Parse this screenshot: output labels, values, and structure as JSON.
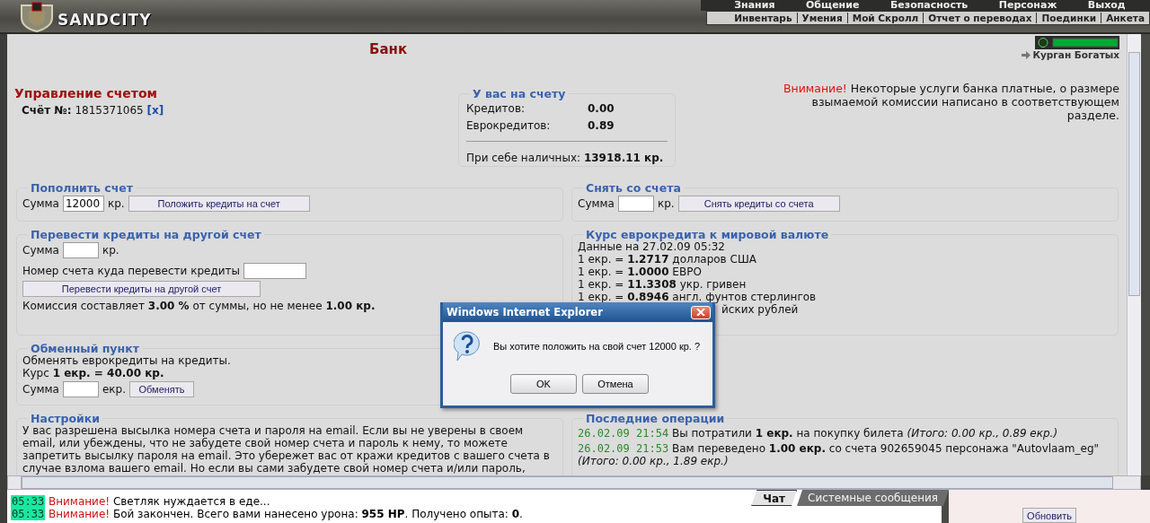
{
  "header": {
    "logo": "SANDCITY",
    "menu": [
      "Знания",
      "Общение",
      "Безопасность",
      "Персонаж",
      "Выход"
    ],
    "submenu": [
      "Инвентарь",
      "Умения",
      "Мой Скролл",
      "Отчет о переводах",
      "Поединки",
      "Анкета"
    ]
  },
  "page": {
    "title": "Банк",
    "location": "Курган Богатых"
  },
  "account": {
    "heading": "Управление счетом",
    "number_label": "Счёт №:",
    "number": "1815371065",
    "close_link": "[x]"
  },
  "balance": {
    "legend": "У вас на счету",
    "rows": [
      {
        "label": "Кредитов:",
        "value": "0.00"
      },
      {
        "label": "Еврокредитов:",
        "value": "0.89"
      }
    ],
    "cash_label": "При себе наличных:",
    "cash": "13918.11 кр."
  },
  "notice": {
    "alert": "Внимание!",
    "text": "Некоторые услуги банка платные, о размере взымаемой комиссии написано в соответствующем разделе."
  },
  "deposit": {
    "legend": "Пополнить счет",
    "amount_label": "Сумма",
    "value": "12000",
    "unit": "кр.",
    "button": "Положить кредиты на счет"
  },
  "withdraw": {
    "legend": "Снять со счета",
    "amount_label": "Сумма",
    "unit": "кр.",
    "button": "Снять кредиты со счета"
  },
  "transfer": {
    "legend": "Перевести кредиты на другой счет",
    "amount_label": "Сумма",
    "unit": "кр.",
    "account_label": "Номер счета куда перевести кредиты",
    "button": "Перевести кредиты на другой счет",
    "fee": "Комиссия составляет **3.00 %** от суммы, но не менее **1.00 кр.**"
  },
  "rates": {
    "legend": "Курс еврокредита к мировой валюте",
    "date": "Данные на 27.02.09 05:32",
    "lines": [
      "1 екр. = **1.2717** долларов США",
      "1 екр. = **1.0000** ЕВРО",
      "1 екр. = **11.3308** укр. гривен",
      "1 екр. = **0.8946** англ. фунтов стерлингов"
    ],
    "partly_hidden_line": "йских рублей"
  },
  "exchange": {
    "legend": "Обменный пункт",
    "text": "Обменять еврокредиты на кредиты.",
    "rate": "Курс **1 екр. = 40.00 кр.**",
    "amount_label": "Сумма",
    "unit": "екр.",
    "button": "Обменять"
  },
  "settings": {
    "legend": "Настройки",
    "text": "У вас разрешена высылка номера счета и пароля на email. Если вы не уверены в своем email, или убеждены, что не забудете свой номер счета и пароль к нему, то можете запретить высылку пароля на email. Это убережет вас от кражи кредитов с вашего счета в случае взлома вашего email. Но если вы сами забудете свой номер счета и/или пароль,"
  },
  "operations": {
    "legend": "Последние операции",
    "items": [
      {
        "time": "26.02.09 21:54",
        "text": "Вы потратили **1 екр.** на покупку билета *(Итого: 0.00 кр., 0.89 екр.)*"
      },
      {
        "time": "26.02.09 21:53",
        "text": "Вам переведено **1.00 екр.** со счета 902659045 персонажа \"Autovlaam_eg\" *(Итого: 0.00 кр., 1.89 екр.)*"
      }
    ]
  },
  "dialog": {
    "title": "Windows Internet Explorer",
    "message": "Вы хотите положить на свой счет 12000 кр. ?",
    "buttons": [
      "OK",
      "Отмена"
    ]
  },
  "chat": {
    "messages": [
      {
        "time": "05:33",
        "alert": "Внимание!",
        "text": "Светляк нуждается в еде..."
      },
      {
        "time": "05:33",
        "alert": "Внимание!",
        "text": "Бой закончен. Всего вами нанесено урона: **955 HP**. Получено опыта: **0**."
      }
    ],
    "tabs": [
      {
        "label": "Чат",
        "selected": true
      },
      {
        "label": "Системные сообщения",
        "selected": false
      }
    ],
    "refresh_button": "Обновить"
  }
}
